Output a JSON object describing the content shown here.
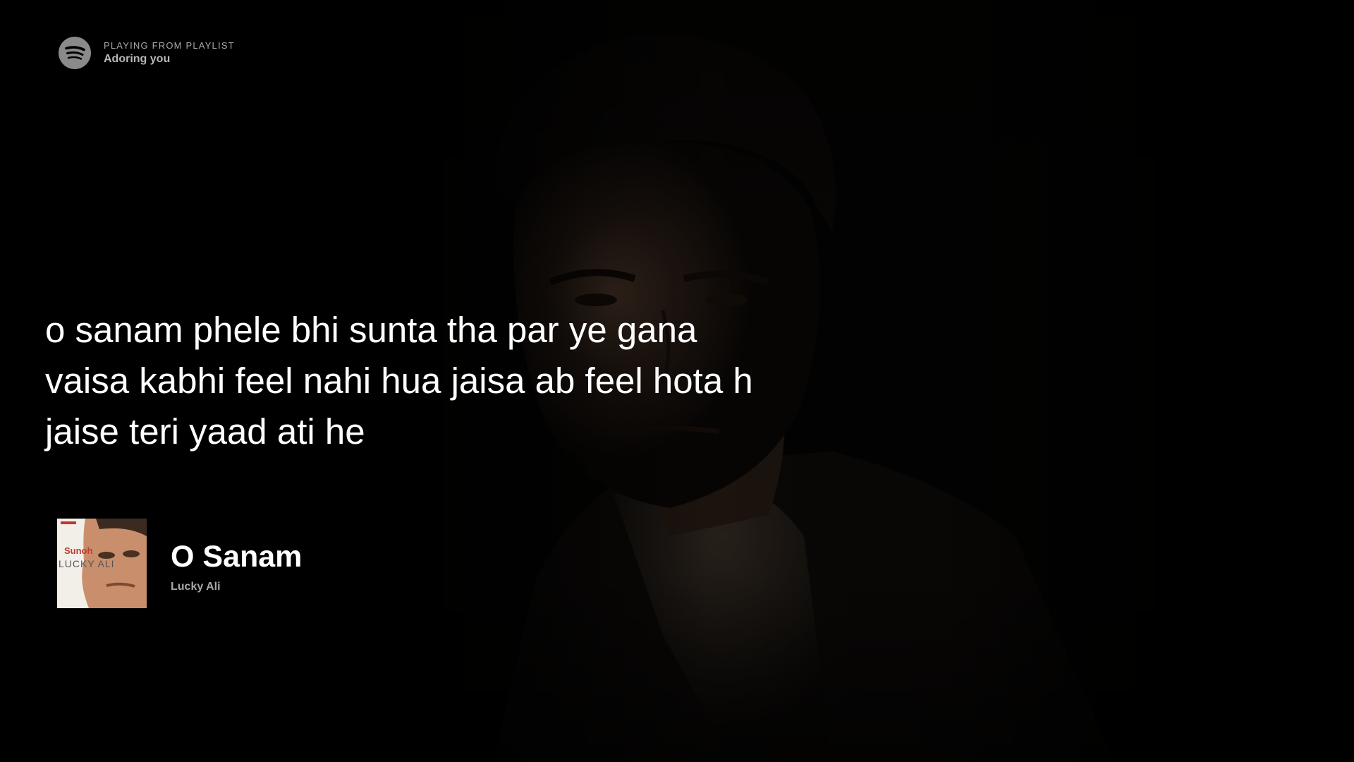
{
  "header": {
    "context_label": "PLAYING FROM PLAYLIST",
    "playlist_name": "Adoring you",
    "logo_icon": "spotify-logo-icon"
  },
  "lyrics": {
    "lines": [
      "o sanam phele bhi sunta tha par ye gana",
      "vaisa kabhi feel nahi hua jaisa ab feel hota h",
      "jaise teri yaad ati he"
    ]
  },
  "track": {
    "title": "O Sanam",
    "artist": "Lucky Ali",
    "album_art": {
      "label_top": "Sunoh",
      "label_name": "LUCKY ALI"
    }
  },
  "colors": {
    "background": "#000000",
    "lyric_text": "#ffffff",
    "muted_text": "#a8a8a8",
    "logo_gray": "#8a8a8a"
  }
}
